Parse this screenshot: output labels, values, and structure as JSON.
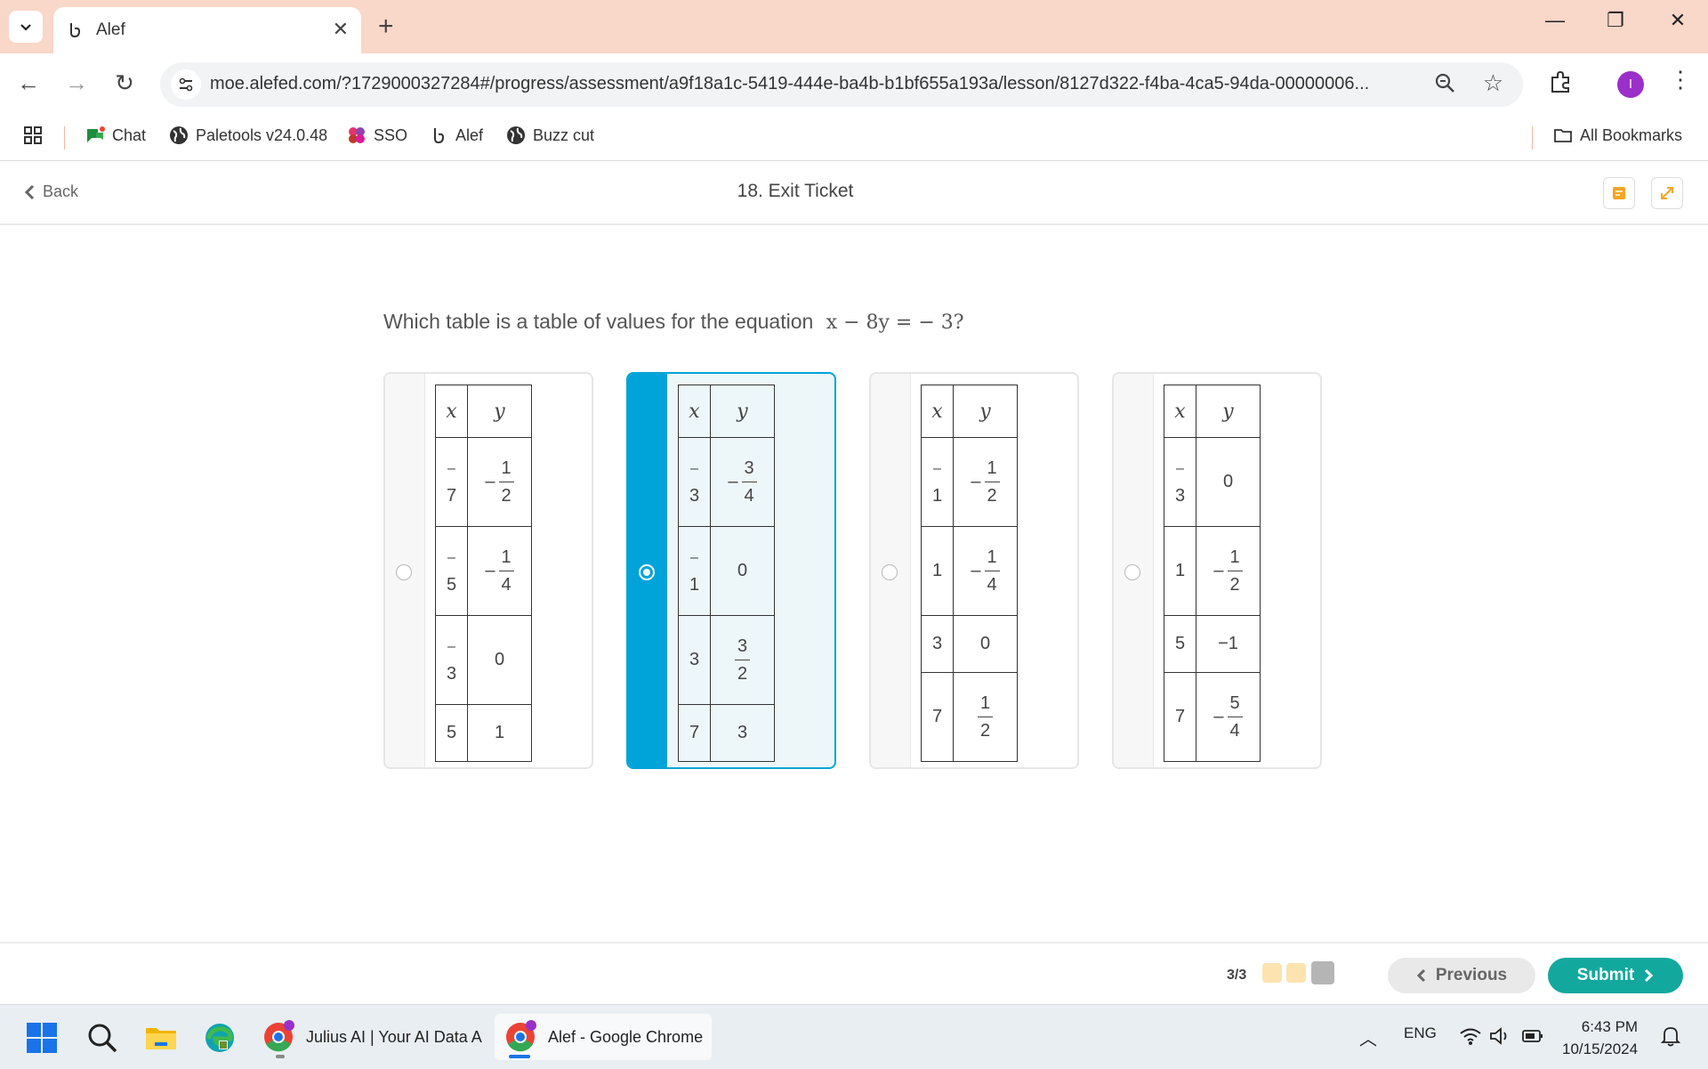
{
  "browser": {
    "tab_title": "Alef",
    "url": "moe.alefed.com/?1729000327284#/progress/assessment/a9f18a1c-5419-444e-ba4b-b1bf655a193a/lesson/8127d322-f4ba-4ca5-94da-00000006...",
    "avatar_letter": "I",
    "bookmarks": [
      {
        "label": "Chat",
        "icon": "chat-icon"
      },
      {
        "label": "Paletools v24.0.48",
        "icon": "globe-icon"
      },
      {
        "label": "SSO",
        "icon": "sso-icon"
      },
      {
        "label": "Alef",
        "icon": "alef-icon"
      },
      {
        "label": "Buzz cut",
        "icon": "globe-icon"
      }
    ],
    "all_bookmarks": "All Bookmarks"
  },
  "header": {
    "back_label": "Back",
    "title": "18. Exit Ticket"
  },
  "question": {
    "text": "Which table is a table of values for the equation",
    "equation": "x − 8y = − 3?"
  },
  "options": [
    {
      "selected": false,
      "header": [
        "x",
        "y"
      ],
      "rows": [
        {
          "x": "-7",
          "y": "-1/2"
        },
        {
          "x": "-5",
          "y": "-1/4"
        },
        {
          "x": "-3",
          "y": "0"
        },
        {
          "x": "5",
          "y": "1"
        }
      ]
    },
    {
      "selected": true,
      "header": [
        "x",
        "y"
      ],
      "rows": [
        {
          "x": "-3",
          "y": "-3/4"
        },
        {
          "x": "-1",
          "y": "0"
        },
        {
          "x": "3",
          "y": "3/2"
        },
        {
          "x": "7",
          "y": "3"
        }
      ]
    },
    {
      "selected": false,
      "header": [
        "x",
        "y"
      ],
      "rows": [
        {
          "x": "-1",
          "y": "-1/2"
        },
        {
          "x": "1",
          "y": "-1/4"
        },
        {
          "x": "3",
          "y": "0"
        },
        {
          "x": "7",
          "y": "1/2"
        }
      ]
    },
    {
      "selected": false,
      "header": [
        "x",
        "y"
      ],
      "rows": [
        {
          "x": "-3",
          "y": "0"
        },
        {
          "x": "1",
          "y": "-1/2"
        },
        {
          "x": "5",
          "y": "−1"
        },
        {
          "x": "7",
          "y": "-5/4"
        }
      ]
    }
  ],
  "footer": {
    "progress": "3/3",
    "progress_dots": [
      "#fde3b0",
      "#fde3b0",
      "#b5b5b5"
    ],
    "previous_label": "Previous",
    "submit_label": "Submit"
  },
  "taskbar": {
    "apps": [
      {
        "label": "Julius AI | Your AI Data A",
        "active": false
      },
      {
        "label": "Alef - Google Chrome",
        "active": true
      }
    ],
    "language": "ENG",
    "time": "6:43 PM",
    "date": "10/15/2024"
  },
  "colors": {
    "accent": "#00a4d9",
    "submit": "#13a89e",
    "tabstrip": "#f9d7c9"
  }
}
